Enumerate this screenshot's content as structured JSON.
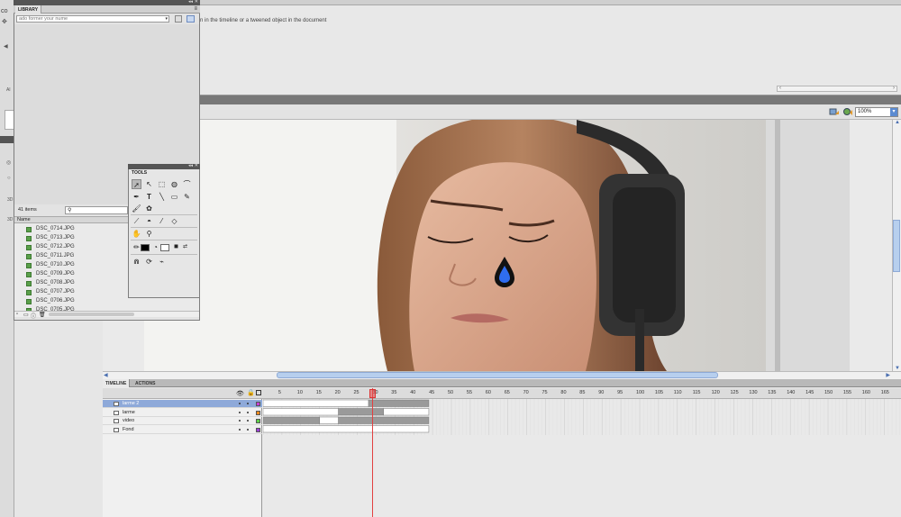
{
  "top_panel": {
    "hint": "n in the timeline or a tweened object in the document"
  },
  "left_dock": {
    "labels": [
      "CO",
      "Al",
      "3D",
      "3D"
    ]
  },
  "library": {
    "title": "LIBRARY",
    "document_placeholder": "ado former your nume",
    "count": "41 items",
    "search_placeholder": "",
    "column_name": "Name",
    "items": [
      "DSC_0714.JPG",
      "DSC_0713.JPG",
      "DSC_0712.JPG",
      "DSC_0711.JPG",
      "DSC_0710.JPG",
      "DSC_0709.JPG",
      "DSC_0708.JPG",
      "DSC_0707.JPG",
      "DSC_0706.JPG",
      "DSC_0705.JPG"
    ]
  },
  "tools": {
    "title": "TOOLS"
  },
  "stage": {
    "zoom": "100%"
  },
  "timeline": {
    "tab_timeline": "TIMELINE",
    "tab_actions": "ACTIONS",
    "frame_ticks": [
      "5",
      "10",
      "15",
      "20",
      "25",
      "30",
      "35",
      "40",
      "45",
      "50",
      "55",
      "60",
      "65",
      "70",
      "75",
      "80",
      "85",
      "90",
      "95",
      "100",
      "105",
      "110",
      "115",
      "120",
      "125",
      "130",
      "135",
      "140",
      "145",
      "150",
      "155",
      "160",
      "165"
    ],
    "current_frame": 30,
    "layers": [
      {
        "name": "larme 2",
        "color": "#c63fd6",
        "selected": true
      },
      {
        "name": "larme",
        "color": "#f08a1c",
        "selected": false
      },
      {
        "name": "video",
        "color": "#5ed14a",
        "selected": false
      },
      {
        "name": "Fond",
        "color": "#9b3fd6",
        "selected": false
      }
    ]
  }
}
